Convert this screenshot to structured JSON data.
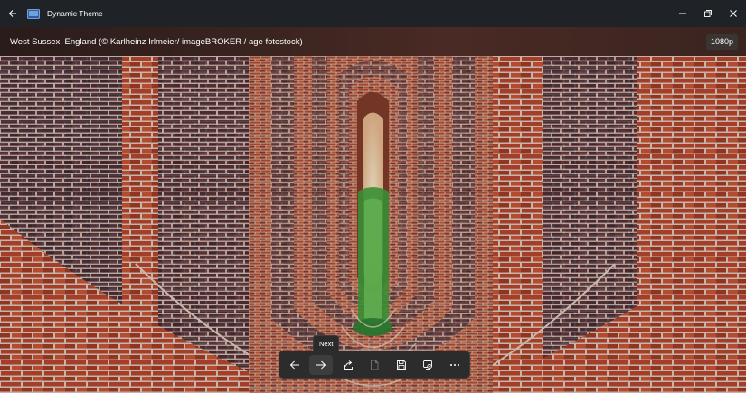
{
  "window": {
    "title": "Dynamic Theme"
  },
  "image_info": {
    "caption": "West Sussex, England (© Karlheinz Irlmeier/ imageBROKER / age fotostock)",
    "resolution": "1080p"
  },
  "toolbar": {
    "tooltip": "Next",
    "buttons": [
      {
        "icon": "arrow-left-icon"
      },
      {
        "icon": "arrow-right-icon"
      },
      {
        "icon": "share-icon"
      },
      {
        "icon": "document-icon"
      },
      {
        "icon": "save-icon"
      },
      {
        "icon": "set-wallpaper-icon"
      },
      {
        "icon": "more-icon"
      }
    ]
  },
  "colors": {
    "titlebar": "#1f2327",
    "brick": "#b5442c",
    "mortar": "#d8c8bc",
    "dark_brick": "#3a2a35",
    "greenery": "#3f9a3a"
  }
}
